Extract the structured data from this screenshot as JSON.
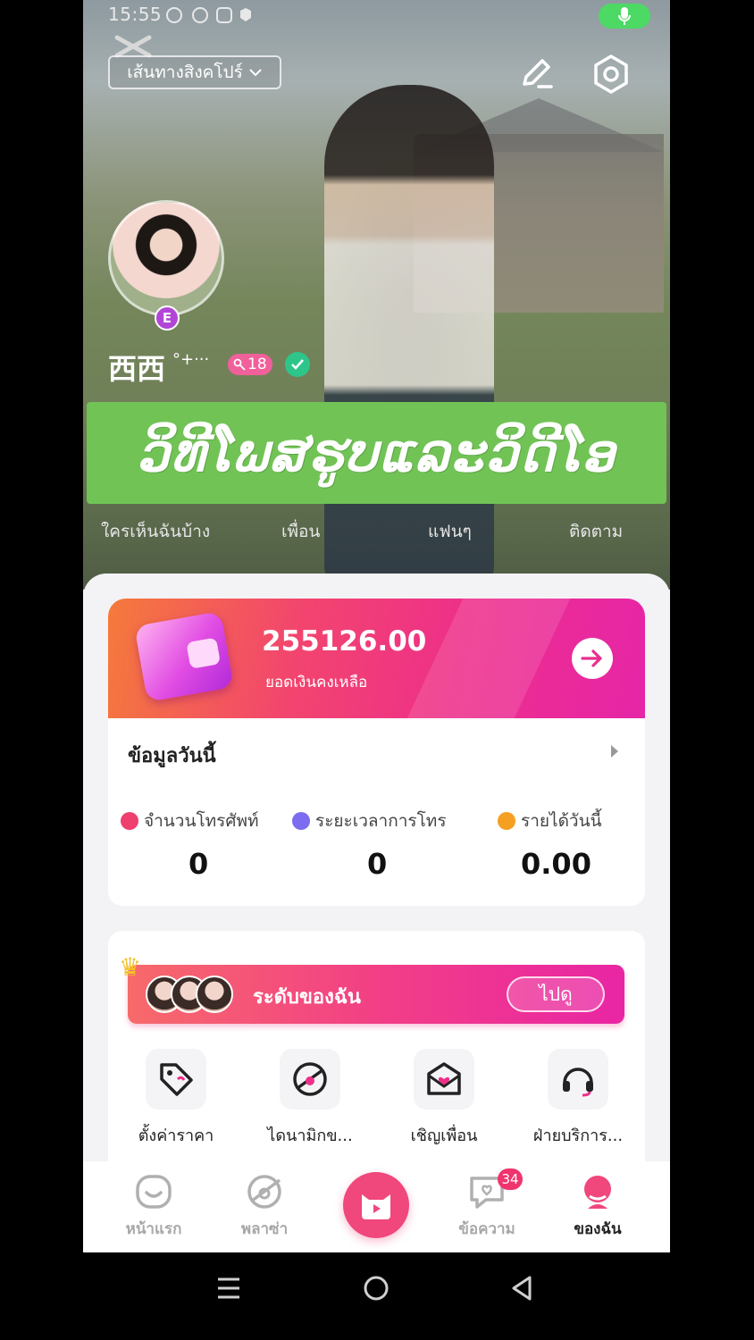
{
  "status_bar": {
    "time": "15:55"
  },
  "header": {
    "route_label": "เส้นทางสิงคโปร์",
    "edit_icon": "edit-icon",
    "settings_icon": "settings-icon"
  },
  "profile": {
    "username": "西西",
    "username_suffix": "°+···",
    "avatar_badge": "E",
    "level_badge": "18"
  },
  "banner": {
    "text": "ວິທີໂພສຮູບແລະວິດີໂອ"
  },
  "profile_stats": [
    {
      "label": "ใครเห็นฉันบ้าง"
    },
    {
      "label": "เพื่อน"
    },
    {
      "label": "แฟนๆ"
    },
    {
      "label": "ติดตาม"
    }
  ],
  "wallet": {
    "amount": "255126.00",
    "label": "ยอดเงินคงเหลือ"
  },
  "today": {
    "title": "ข้อมูลวันนี้",
    "metrics": [
      {
        "label": "จำนวนโทรศัพท์",
        "value": "0",
        "color": "#ef3f6f"
      },
      {
        "label": "ระยะเวลาการโทร",
        "value": "0",
        "color": "#7c6cf0"
      },
      {
        "label": "รายได้วันนี้",
        "value": "0.00",
        "color": "#f5a022"
      }
    ]
  },
  "level": {
    "text": "ระดับของฉัน",
    "go_label": "ไปดู"
  },
  "tools": [
    {
      "label": "ตั้งค่าราคา",
      "icon": "price-tag-icon"
    },
    {
      "label": "ไดนามิกข...",
      "icon": "dynamics-icon"
    },
    {
      "label": "เชิญเพื่อน",
      "icon": "invite-icon"
    },
    {
      "label": "ฝ่ายบริการ...",
      "icon": "headset-icon"
    }
  ],
  "bottom_nav": {
    "home": "หน้าแรก",
    "plaza": "พลาซ่า",
    "messages": "ข้อความ",
    "messages_badge": "34",
    "mine": "ของฉัน"
  },
  "colors": {
    "accent": "#f0477c",
    "banner_green": "#71c356",
    "verified": "#2ec58b"
  }
}
